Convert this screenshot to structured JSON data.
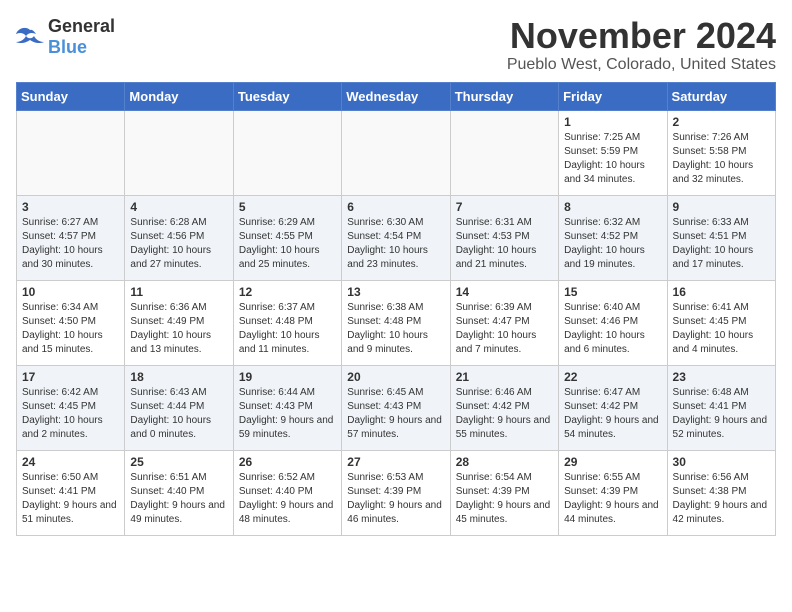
{
  "logo": {
    "general": "General",
    "blue": "Blue"
  },
  "title": "November 2024",
  "location": "Pueblo West, Colorado, United States",
  "days_of_week": [
    "Sunday",
    "Monday",
    "Tuesday",
    "Wednesday",
    "Thursday",
    "Friday",
    "Saturday"
  ],
  "weeks": [
    [
      {
        "day": "",
        "info": ""
      },
      {
        "day": "",
        "info": ""
      },
      {
        "day": "",
        "info": ""
      },
      {
        "day": "",
        "info": ""
      },
      {
        "day": "",
        "info": ""
      },
      {
        "day": "1",
        "info": "Sunrise: 7:25 AM\nSunset: 5:59 PM\nDaylight: 10 hours and 34 minutes."
      },
      {
        "day": "2",
        "info": "Sunrise: 7:26 AM\nSunset: 5:58 PM\nDaylight: 10 hours and 32 minutes."
      }
    ],
    [
      {
        "day": "3",
        "info": "Sunrise: 6:27 AM\nSunset: 4:57 PM\nDaylight: 10 hours and 30 minutes."
      },
      {
        "day": "4",
        "info": "Sunrise: 6:28 AM\nSunset: 4:56 PM\nDaylight: 10 hours and 27 minutes."
      },
      {
        "day": "5",
        "info": "Sunrise: 6:29 AM\nSunset: 4:55 PM\nDaylight: 10 hours and 25 minutes."
      },
      {
        "day": "6",
        "info": "Sunrise: 6:30 AM\nSunset: 4:54 PM\nDaylight: 10 hours and 23 minutes."
      },
      {
        "day": "7",
        "info": "Sunrise: 6:31 AM\nSunset: 4:53 PM\nDaylight: 10 hours and 21 minutes."
      },
      {
        "day": "8",
        "info": "Sunrise: 6:32 AM\nSunset: 4:52 PM\nDaylight: 10 hours and 19 minutes."
      },
      {
        "day": "9",
        "info": "Sunrise: 6:33 AM\nSunset: 4:51 PM\nDaylight: 10 hours and 17 minutes."
      }
    ],
    [
      {
        "day": "10",
        "info": "Sunrise: 6:34 AM\nSunset: 4:50 PM\nDaylight: 10 hours and 15 minutes."
      },
      {
        "day": "11",
        "info": "Sunrise: 6:36 AM\nSunset: 4:49 PM\nDaylight: 10 hours and 13 minutes."
      },
      {
        "day": "12",
        "info": "Sunrise: 6:37 AM\nSunset: 4:48 PM\nDaylight: 10 hours and 11 minutes."
      },
      {
        "day": "13",
        "info": "Sunrise: 6:38 AM\nSunset: 4:48 PM\nDaylight: 10 hours and 9 minutes."
      },
      {
        "day": "14",
        "info": "Sunrise: 6:39 AM\nSunset: 4:47 PM\nDaylight: 10 hours and 7 minutes."
      },
      {
        "day": "15",
        "info": "Sunrise: 6:40 AM\nSunset: 4:46 PM\nDaylight: 10 hours and 6 minutes."
      },
      {
        "day": "16",
        "info": "Sunrise: 6:41 AM\nSunset: 4:45 PM\nDaylight: 10 hours and 4 minutes."
      }
    ],
    [
      {
        "day": "17",
        "info": "Sunrise: 6:42 AM\nSunset: 4:45 PM\nDaylight: 10 hours and 2 minutes."
      },
      {
        "day": "18",
        "info": "Sunrise: 6:43 AM\nSunset: 4:44 PM\nDaylight: 10 hours and 0 minutes."
      },
      {
        "day": "19",
        "info": "Sunrise: 6:44 AM\nSunset: 4:43 PM\nDaylight: 9 hours and 59 minutes."
      },
      {
        "day": "20",
        "info": "Sunrise: 6:45 AM\nSunset: 4:43 PM\nDaylight: 9 hours and 57 minutes."
      },
      {
        "day": "21",
        "info": "Sunrise: 6:46 AM\nSunset: 4:42 PM\nDaylight: 9 hours and 55 minutes."
      },
      {
        "day": "22",
        "info": "Sunrise: 6:47 AM\nSunset: 4:42 PM\nDaylight: 9 hours and 54 minutes."
      },
      {
        "day": "23",
        "info": "Sunrise: 6:48 AM\nSunset: 4:41 PM\nDaylight: 9 hours and 52 minutes."
      }
    ],
    [
      {
        "day": "24",
        "info": "Sunrise: 6:50 AM\nSunset: 4:41 PM\nDaylight: 9 hours and 51 minutes."
      },
      {
        "day": "25",
        "info": "Sunrise: 6:51 AM\nSunset: 4:40 PM\nDaylight: 9 hours and 49 minutes."
      },
      {
        "day": "26",
        "info": "Sunrise: 6:52 AM\nSunset: 4:40 PM\nDaylight: 9 hours and 48 minutes."
      },
      {
        "day": "27",
        "info": "Sunrise: 6:53 AM\nSunset: 4:39 PM\nDaylight: 9 hours and 46 minutes."
      },
      {
        "day": "28",
        "info": "Sunrise: 6:54 AM\nSunset: 4:39 PM\nDaylight: 9 hours and 45 minutes."
      },
      {
        "day": "29",
        "info": "Sunrise: 6:55 AM\nSunset: 4:39 PM\nDaylight: 9 hours and 44 minutes."
      },
      {
        "day": "30",
        "info": "Sunrise: 6:56 AM\nSunset: 4:38 PM\nDaylight: 9 hours and 42 minutes."
      }
    ]
  ]
}
